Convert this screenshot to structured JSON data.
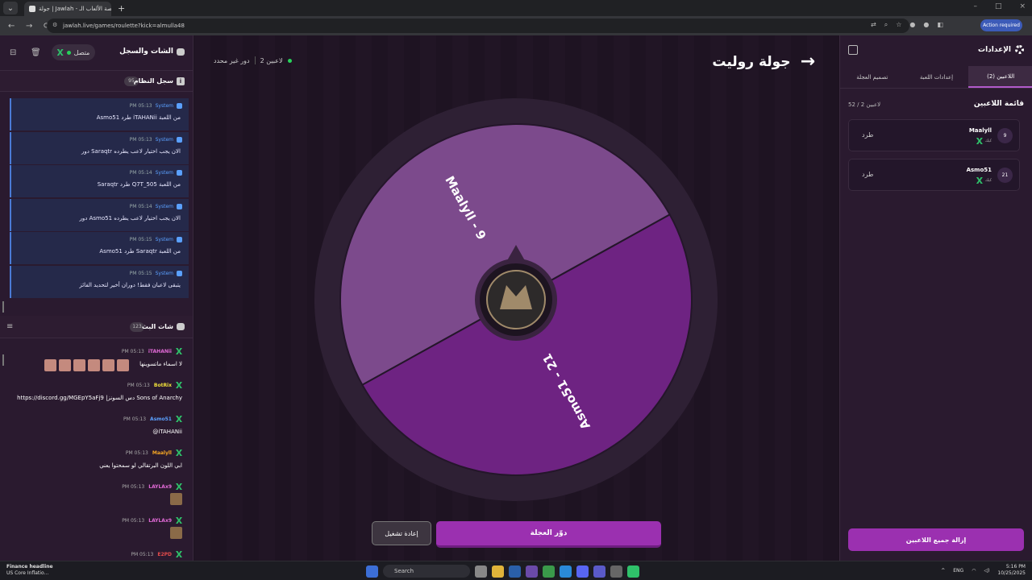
{
  "browser": {
    "tab_title": "جولة | Jawlah - منصة الألعاب الـ",
    "url": "jawlah.live/games/roulette?kick=almulla48",
    "action_label": "Action required",
    "nav": {
      "back": "←",
      "forward": "→",
      "reload": "⟳",
      "new_tab": "+",
      "tab_close": "×"
    },
    "window_controls": {
      "minimize": "–",
      "maximize": "□",
      "close": "×"
    }
  },
  "left_panel": {
    "title": "الشات والسجل",
    "status": "متصل",
    "system_log": {
      "title": "سجل النظام",
      "count": "95",
      "messages": [
        {
          "sender": "System",
          "time": "PM 05:13",
          "text": "Asmo51 طرد iTAHANii من اللعبة"
        },
        {
          "sender": "System",
          "time": "PM 05:13",
          "text": "دور Saraqtr الان يجب اختيار لاعب يطرده"
        },
        {
          "sender": "System",
          "time": "PM 05:14",
          "text": "Saraqtr طرد Q7T_505 من اللعبة"
        },
        {
          "sender": "System",
          "time": "PM 05:14",
          "text": "دور Asmo51 الان يجب اختيار لاعب يطرده"
        },
        {
          "sender": "System",
          "time": "PM 05:15",
          "text": "Asmo51 طرد Saraqtr من اللعبة"
        },
        {
          "sender": "System",
          "time": "PM 05:15",
          "text": "يتبقى لاعبان فقط! دوران أخير لتحديد الفائز"
        }
      ]
    },
    "stream_chat": {
      "title": "شات البث",
      "count": "123",
      "messages": [
        {
          "name": "iTAHANii",
          "time": "PM 05:13",
          "text": "لا اسماء ماتسوينها",
          "color": "#e36bd8"
        },
        {
          "name": "BotRix",
          "time": "PM 05:13",
          "text": "https://discord.gg/MGEpY5aFj9 |دس السونز Sons of Anarchy",
          "color": "#f0e03a"
        },
        {
          "name": "Asmo51",
          "time": "PM 05:13",
          "text": "@iTAHANii",
          "color": "#5aa0ff"
        },
        {
          "name": "Maalyll",
          "time": "PM 05:13",
          "text": "ابي اللون البرتقالي لو سمحتوا يعني",
          "color": "#f5a623"
        },
        {
          "name": "LAYLAx9",
          "time": "PM 05:13",
          "text": "",
          "color": "#e36bd8"
        },
        {
          "name": "LAYLAx9",
          "time": "PM 05:13",
          "text": "",
          "color": "#e36bd8"
        },
        {
          "name": "E2PD",
          "time": "PM 05:13",
          "text": "",
          "color": "#e34b4b"
        }
      ]
    }
  },
  "center": {
    "title": "جولة روليت",
    "players_info": "2 لاعبين",
    "round_info": "دور غير محدد",
    "spin_label": "دوّر العجلة",
    "replay_label": "إعادة تشغيل",
    "wheel": {
      "segments": [
        {
          "label": "Asmo51 - 21",
          "color": "#6e2382",
          "share": 0.5
        },
        {
          "label": "Maalyll - 9",
          "color": "#7c4a8c",
          "share": 0.5
        }
      ]
    }
  },
  "right_panel": {
    "title": "الإعدادات",
    "tabs": [
      "اللاعبين (2)",
      "إعدادات اللعبة",
      "تصميم العجلة"
    ],
    "players_title": "قائمة اللاعبين",
    "players_count": "52 / 2 لاعبين",
    "players": [
      {
        "number": "9",
        "name": "Maalyll",
        "platform": "كيك",
        "kick_label": "طرد"
      },
      {
        "number": "21",
        "name": "Asmo51",
        "platform": "كيك",
        "kick_label": "طرد"
      }
    ],
    "remove_all_label": "إزالة جميع اللاعبين"
  },
  "taskbar": {
    "news_title": "Finance headline",
    "news_sub": "US Core Inflatio...",
    "search": "Search",
    "lang": "ENG",
    "time": "5:16 PM",
    "date": "10/25/2025"
  },
  "colors": {
    "accent": "#9b30b0",
    "online": "#27d35a",
    "kick_green": "#2fc16a"
  }
}
